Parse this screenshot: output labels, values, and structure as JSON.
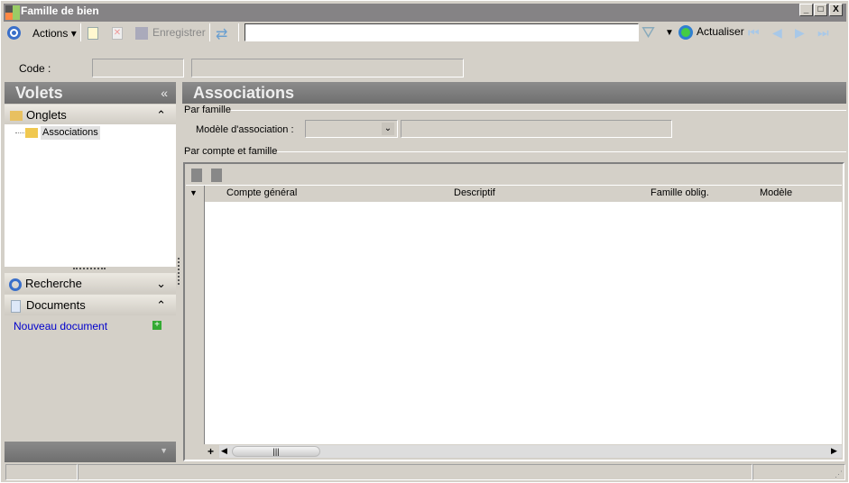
{
  "window": {
    "title": "Famille de bien",
    "min": "_",
    "max": "□",
    "close": "X"
  },
  "toolbar": {
    "actions": "Actions",
    "save": "Enregistrer",
    "search_value": "",
    "refresh": "Actualiser"
  },
  "code": {
    "label": "Code :",
    "value1": "",
    "value2": ""
  },
  "left": {
    "title": "Volets",
    "collapse": "«",
    "onglets": "Onglets",
    "tree_item": "Associations",
    "recherche": "Recherche",
    "documents": "Documents",
    "new_doc": "Nouveau document"
  },
  "main": {
    "title": "Associations",
    "group1": "Par famille",
    "model_label": "Modèle d'association :",
    "model_value": "",
    "model_desc": "",
    "group2": "Par compte et famille",
    "columns": [
      "Compte général",
      "Descriptif",
      "Famille oblig.",
      "Modèle"
    ],
    "add_row": "+"
  },
  "status": {
    "cells": [
      "",
      "",
      ""
    ]
  },
  "colors": {
    "header": "#7a7a7a",
    "link": "#0000cc"
  }
}
